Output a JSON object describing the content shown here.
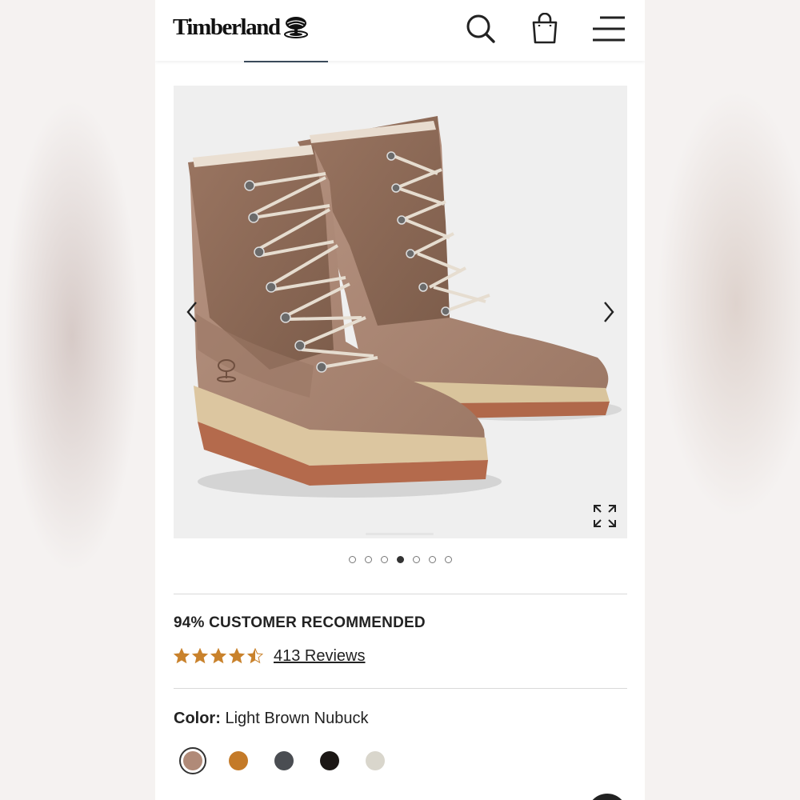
{
  "header": {
    "brand": "Timberland",
    "icons": [
      "search-icon",
      "bag-icon",
      "menu-icon"
    ]
  },
  "gallery": {
    "image_alt": "Light brown nubuck fold-down lace-up boots",
    "prev_icon": "chevron-left-icon",
    "next_icon": "chevron-right-icon",
    "expand_icon": "expand-icon",
    "total_images": 7,
    "active_index": 3
  },
  "ratings": {
    "recommend_text": "94% CUSTOMER RECOMMENDED",
    "stars": 4.5,
    "star_color": "#c9822c",
    "reviews_text": "413 Reviews"
  },
  "color": {
    "label": "Color:",
    "value": "Light Brown Nubuck",
    "swatches": [
      {
        "name": "Light Brown Nubuck",
        "hex": "#b08a78",
        "selected": true
      },
      {
        "name": "Wheat",
        "hex": "#c47a28",
        "selected": false
      },
      {
        "name": "Dark Grey",
        "hex": "#4a4d52",
        "selected": false
      },
      {
        "name": "Black",
        "hex": "#1c1715",
        "selected": false
      },
      {
        "name": "Cream",
        "hex": "#d9d6cc",
        "selected": false
      }
    ]
  }
}
